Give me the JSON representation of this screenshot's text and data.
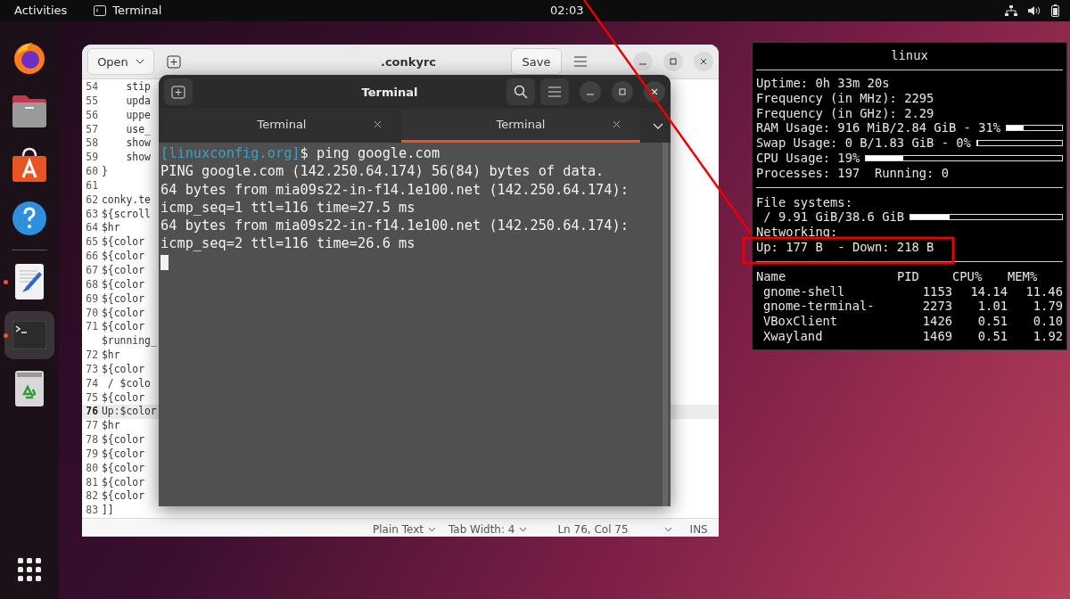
{
  "top_bar": {
    "activities": "Activities",
    "app": "Terminal",
    "clock": "02:03"
  },
  "dock": {
    "items": [
      {
        "kind": "firefox",
        "running": false,
        "selected": false
      },
      {
        "kind": "files",
        "running": false,
        "selected": false
      },
      {
        "kind": "software",
        "running": false,
        "selected": false
      },
      {
        "kind": "help",
        "running": false,
        "selected": false
      },
      {
        "kind": "editor",
        "running": true,
        "selected": false
      },
      {
        "kind": "terminal",
        "running": true,
        "selected": true
      },
      {
        "kind": "trash",
        "running": false,
        "selected": false
      }
    ]
  },
  "editor": {
    "title": ".conkyrc",
    "open_button": "Open",
    "save_button": "Save",
    "lines": [
      {
        "number": "54",
        "text": "    stip",
        "current": false
      },
      {
        "number": "55",
        "text": "    upda",
        "current": false
      },
      {
        "number": "56",
        "text": "    uppe",
        "current": false
      },
      {
        "number": "57",
        "text": "    use_",
        "current": false
      },
      {
        "number": "58",
        "text": "    show",
        "current": false
      },
      {
        "number": "59",
        "text": "    show",
        "current": false
      },
      {
        "number": "60",
        "text": "}",
        "current": false
      },
      {
        "number": "61",
        "current": false
      },
      {
        "number": "62",
        "text": "conky.te",
        "current": false
      },
      {
        "number": "63",
        "text": "${scroll",
        "current": false
      },
      {
        "number": "64",
        "text": "$hr",
        "current": false
      },
      {
        "number": "65",
        "text": "${color",
        "current": false
      },
      {
        "number": "66",
        "text": "${color",
        "current": false
      },
      {
        "number": "67",
        "text": "${color",
        "current": false
      },
      {
        "number": "68",
        "text": "${color",
        "current": false
      },
      {
        "number": "69",
        "text": "${color",
        "current": false
      },
      {
        "number": "70",
        "text": "${color",
        "current": false
      },
      {
        "number": "71",
        "text": "${color",
        "current": false
      },
      {
        "text": "$running_",
        "current": false
      },
      {
        "number": "72",
        "text": "$hr",
        "current": false
      },
      {
        "number": "73",
        "text": "${color",
        "current": false
      },
      {
        "number": "74",
        "text": " / $colo",
        "current": false
      },
      {
        "number": "75",
        "text": "${color",
        "current": false
      },
      {
        "number": "76",
        "text": "Up:$color",
        "current": true
      },
      {
        "number": "77",
        "text": "$hr",
        "current": false
      },
      {
        "number": "78",
        "text": "${color",
        "current": false
      },
      {
        "number": "79",
        "text": "${color",
        "current": false
      },
      {
        "number": "80",
        "text": "${color",
        "current": false
      },
      {
        "number": "81",
        "text": "${color",
        "current": false
      },
      {
        "number": "82",
        "text": "${color",
        "current": false
      },
      {
        "number": "83",
        "text": "]]",
        "current": false
      }
    ],
    "status": {
      "language": "Plain Text",
      "tab_width": "Tab Width: 4",
      "position": "Ln 76, Col 75",
      "mode": "INS"
    }
  },
  "terminal": {
    "title": "Terminal",
    "tabs": [
      {
        "label": "Terminal",
        "selected": false
      },
      {
        "label": "Terminal",
        "selected": true
      }
    ],
    "prompt": "[linuxconfig.org]",
    "command": "$ ping google.com",
    "output": [
      "PING google.com (142.250.64.174) 56(84) bytes of data.",
      "64 bytes from mia09s22-in-f14.1e100.net (142.250.64.174):",
      "icmp_seq=1 ttl=116 time=27.5 ms",
      "64 bytes from mia09s22-in-f14.1e100.net (142.250.64.174):",
      "icmp_seq=2 ttl=116 time=26.6 ms"
    ]
  },
  "conky": {
    "title": "linux",
    "lines": [
      {
        "kind": "rule"
      },
      {
        "kind": "text",
        "text": "Uptime: 0h 33m 20s"
      },
      {
        "kind": "text",
        "text": "Frequency (in MHz): 2295"
      },
      {
        "kind": "text",
        "text": "Frequency (in GHz): 2.29"
      },
      {
        "kind": "bar",
        "text": "RAM Usage: 916 MiB/2.84 GiB - 31%",
        "level": 0.31
      },
      {
        "kind": "bar",
        "text": "Swap Usage: 0 B/1.83 GiB - 0%",
        "level": 0
      },
      {
        "kind": "bar",
        "text": "CPU Usage: 19%",
        "level": 0.19
      },
      {
        "kind": "text",
        "text": "Processes: 197  Running: 0"
      },
      {
        "kind": "rule"
      },
      {
        "kind": "text",
        "text": "File systems:"
      },
      {
        "kind": "bar",
        "text": " / 9.91 GiB/38.6 GiB",
        "level": 0.26
      },
      {
        "kind": "text",
        "text": "Networking:"
      },
      {
        "kind": "text",
        "text": "Up: 177 B  - Down: 218 B"
      },
      {
        "kind": "rule"
      }
    ],
    "columns": [
      "Name",
      "PID",
      "CPU%",
      "MEM%"
    ],
    "processes": [
      [
        "gnome-shell",
        "1153",
        "14.14",
        "11.46"
      ],
      [
        "gnome-terminal-",
        "2273",
        "1.01",
        "1.79"
      ],
      [
        "VBoxClient",
        "1426",
        "0.51",
        "0.10"
      ],
      [
        "Xwayland",
        "1469",
        "0.51",
        "1.92"
      ]
    ]
  }
}
